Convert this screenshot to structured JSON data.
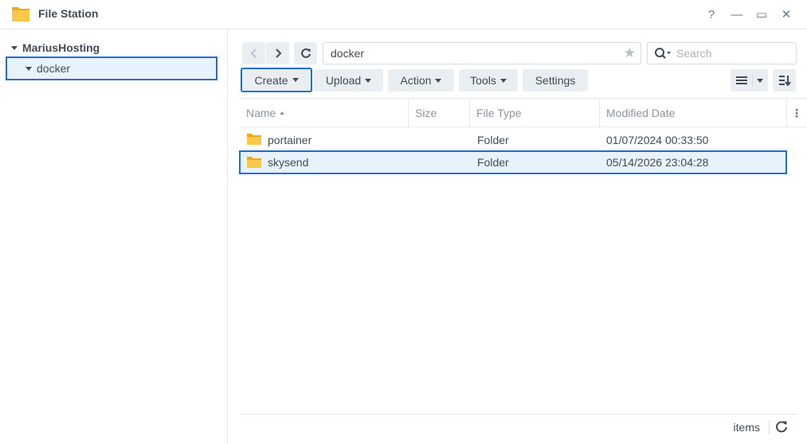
{
  "window": {
    "title": "File Station"
  },
  "window_controls": {
    "help": "?",
    "minimize": "—",
    "maximize": "▭",
    "close": "✕"
  },
  "tree": {
    "root_label": "MariusHosting",
    "child_label": "docker"
  },
  "path": {
    "value": "docker"
  },
  "search": {
    "placeholder": "Search"
  },
  "toolbar": {
    "create": "Create",
    "upload": "Upload",
    "action": "Action",
    "tools": "Tools",
    "settings": "Settings"
  },
  "columns": {
    "name": "Name",
    "size": "Size",
    "type": "File Type",
    "modified": "Modified Date"
  },
  "files": [
    {
      "name": "portainer",
      "size": "",
      "type": "Folder",
      "modified": "01/07/2024 00:33:50"
    },
    {
      "name": "skysend",
      "size": "",
      "type": "Folder",
      "modified": "05/14/2026 23:04:28"
    }
  ],
  "footer": {
    "items_label": "items"
  },
  "colors": {
    "accent": "#1a6fd8",
    "selection": "#e7f2fd",
    "folder": "#f6c343"
  }
}
